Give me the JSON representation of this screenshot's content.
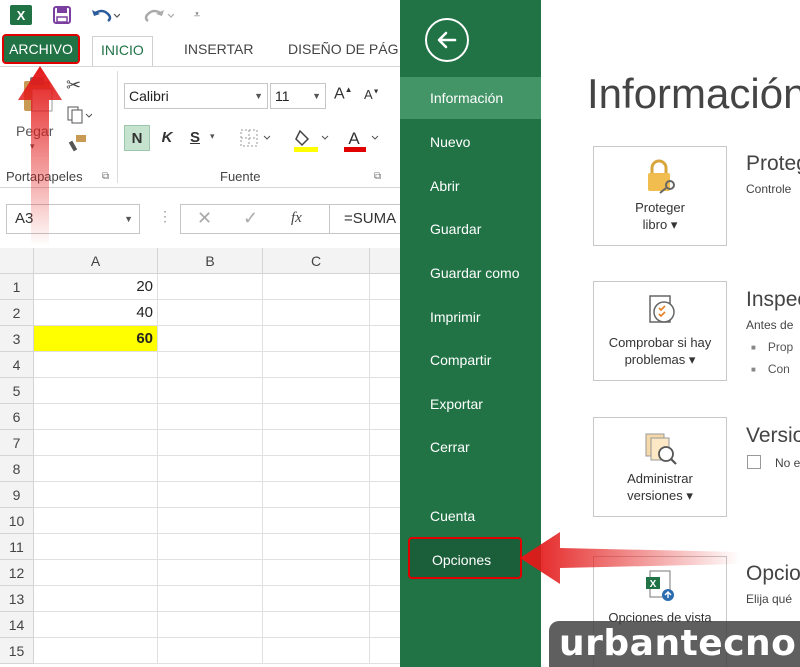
{
  "ribbon": {
    "tabs": [
      "ARCHIVO",
      "INICIO",
      "INSERTAR",
      "DISEÑO DE PÁG"
    ],
    "font_name": "Calibri",
    "font_size": "11",
    "bold_label": "N",
    "italic_label": "K",
    "underline_label": "S",
    "paste_label": "Pegar",
    "groups": [
      "Portapapeles",
      "Fuente"
    ]
  },
  "formula_bar": {
    "name_box": "A3",
    "fx_label": "fx",
    "formula": "=SUMA"
  },
  "grid": {
    "columns": [
      "A",
      "B",
      "C"
    ],
    "rows": [
      "1",
      "2",
      "3",
      "4",
      "5",
      "6",
      "7",
      "8",
      "9",
      "10",
      "11",
      "12",
      "13",
      "14",
      "15"
    ],
    "values": [
      {
        "row": "1",
        "col": "A",
        "value": "20"
      },
      {
        "row": "2",
        "col": "A",
        "value": "40"
      },
      {
        "row": "3",
        "col": "A",
        "value": "60",
        "highlight": "#ffff00"
      }
    ]
  },
  "backstage": {
    "items": [
      "Información",
      "Nuevo",
      "Abrir",
      "Guardar",
      "Guardar como",
      "Imprimir",
      "Compartir",
      "Exportar",
      "Cerrar",
      "Cuenta",
      "Opciones"
    ],
    "accent": "#217346",
    "selected_color": "#439467"
  },
  "info_panel": {
    "title": "Información",
    "cards": [
      {
        "label_line1": "Proteger",
        "label_line2": "libro ▾",
        "icon": "lock-key-icon"
      },
      {
        "label_line1": "Comprobar si hay",
        "label_line2": "problemas ▾",
        "icon": "checklist-icon"
      },
      {
        "label_line1": "Administrar",
        "label_line2": "versiones ▾",
        "icon": "versions-icon"
      },
      {
        "label_line1": "Opciones de vista",
        "label_line2": "",
        "icon": "excel-options-icon"
      }
    ],
    "sections": [
      {
        "title": "Proteg",
        "desc": "Controle"
      },
      {
        "title": "Inspec",
        "desc": "Antes de",
        "bullets": [
          "Prop",
          "Con"
        ]
      },
      {
        "title": "Versio",
        "desc": "No e"
      },
      {
        "title": "Opcio",
        "desc": "Elija qué"
      }
    ]
  },
  "watermark": "urbantecno"
}
